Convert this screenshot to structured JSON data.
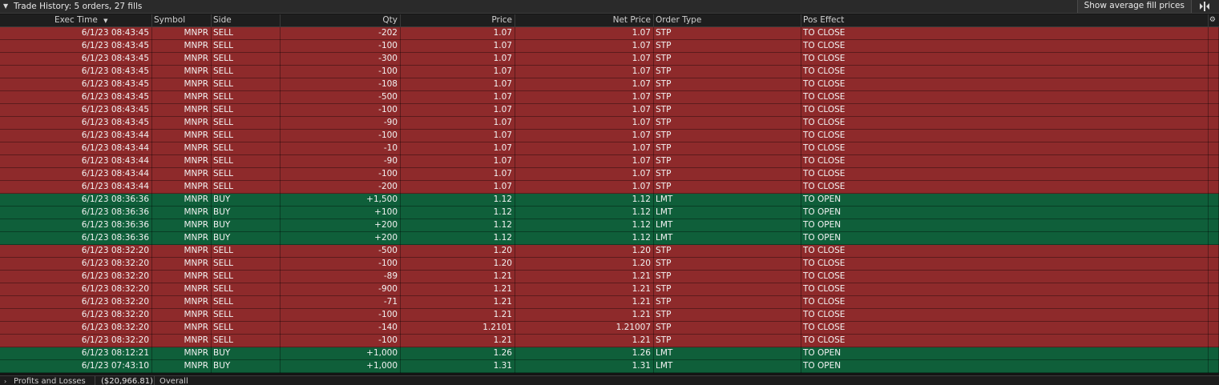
{
  "panel": {
    "title": "Trade History: 5 orders, 27 fills",
    "avg_fill_label": "Show average fill prices"
  },
  "columns": {
    "exec_time": "Exec Time",
    "symbol": "Symbol",
    "side": "Side",
    "qty": "Qty",
    "price": "Price",
    "net_price": "Net Price",
    "order_type": "Order Type",
    "pos_effect": "Pos Effect"
  },
  "colors": {
    "sell_row": "#8e2a2b",
    "buy_row": "#0f5f3a"
  },
  "fills": [
    {
      "time": "6/1/23 08:43:45",
      "symbol": "MNPR",
      "side": "SELL",
      "qty": "-202",
      "price": "1.07",
      "net": "1.07",
      "type": "STP",
      "pos": "TO CLOSE"
    },
    {
      "time": "6/1/23 08:43:45",
      "symbol": "MNPR",
      "side": "SELL",
      "qty": "-100",
      "price": "1.07",
      "net": "1.07",
      "type": "STP",
      "pos": "TO CLOSE"
    },
    {
      "time": "6/1/23 08:43:45",
      "symbol": "MNPR",
      "side": "SELL",
      "qty": "-300",
      "price": "1.07",
      "net": "1.07",
      "type": "STP",
      "pos": "TO CLOSE"
    },
    {
      "time": "6/1/23 08:43:45",
      "symbol": "MNPR",
      "side": "SELL",
      "qty": "-100",
      "price": "1.07",
      "net": "1.07",
      "type": "STP",
      "pos": "TO CLOSE"
    },
    {
      "time": "6/1/23 08:43:45",
      "symbol": "MNPR",
      "side": "SELL",
      "qty": "-108",
      "price": "1.07",
      "net": "1.07",
      "type": "STP",
      "pos": "TO CLOSE"
    },
    {
      "time": "6/1/23 08:43:45",
      "symbol": "MNPR",
      "side": "SELL",
      "qty": "-500",
      "price": "1.07",
      "net": "1.07",
      "type": "STP",
      "pos": "TO CLOSE"
    },
    {
      "time": "6/1/23 08:43:45",
      "symbol": "MNPR",
      "side": "SELL",
      "qty": "-100",
      "price": "1.07",
      "net": "1.07",
      "type": "STP",
      "pos": "TO CLOSE"
    },
    {
      "time": "6/1/23 08:43:45",
      "symbol": "MNPR",
      "side": "SELL",
      "qty": "-90",
      "price": "1.07",
      "net": "1.07",
      "type": "STP",
      "pos": "TO CLOSE"
    },
    {
      "time": "6/1/23 08:43:44",
      "symbol": "MNPR",
      "side": "SELL",
      "qty": "-100",
      "price": "1.07",
      "net": "1.07",
      "type": "STP",
      "pos": "TO CLOSE"
    },
    {
      "time": "6/1/23 08:43:44",
      "symbol": "MNPR",
      "side": "SELL",
      "qty": "-10",
      "price": "1.07",
      "net": "1.07",
      "type": "STP",
      "pos": "TO CLOSE"
    },
    {
      "time": "6/1/23 08:43:44",
      "symbol": "MNPR",
      "side": "SELL",
      "qty": "-90",
      "price": "1.07",
      "net": "1.07",
      "type": "STP",
      "pos": "TO CLOSE"
    },
    {
      "time": "6/1/23 08:43:44",
      "symbol": "MNPR",
      "side": "SELL",
      "qty": "-100",
      "price": "1.07",
      "net": "1.07",
      "type": "STP",
      "pos": "TO CLOSE"
    },
    {
      "time": "6/1/23 08:43:44",
      "symbol": "MNPR",
      "side": "SELL",
      "qty": "-200",
      "price": "1.07",
      "net": "1.07",
      "type": "STP",
      "pos": "TO CLOSE"
    },
    {
      "time": "6/1/23 08:36:36",
      "symbol": "MNPR",
      "side": "BUY",
      "qty": "+1,500",
      "price": "1.12",
      "net": "1.12",
      "type": "LMT",
      "pos": "TO OPEN"
    },
    {
      "time": "6/1/23 08:36:36",
      "symbol": "MNPR",
      "side": "BUY",
      "qty": "+100",
      "price": "1.12",
      "net": "1.12",
      "type": "LMT",
      "pos": "TO OPEN"
    },
    {
      "time": "6/1/23 08:36:36",
      "symbol": "MNPR",
      "side": "BUY",
      "qty": "+200",
      "price": "1.12",
      "net": "1.12",
      "type": "LMT",
      "pos": "TO OPEN"
    },
    {
      "time": "6/1/23 08:36:36",
      "symbol": "MNPR",
      "side": "BUY",
      "qty": "+200",
      "price": "1.12",
      "net": "1.12",
      "type": "LMT",
      "pos": "TO OPEN"
    },
    {
      "time": "6/1/23 08:32:20",
      "symbol": "MNPR",
      "side": "SELL",
      "qty": "-500",
      "price": "1.20",
      "net": "1.20",
      "type": "STP",
      "pos": "TO CLOSE"
    },
    {
      "time": "6/1/23 08:32:20",
      "symbol": "MNPR",
      "side": "SELL",
      "qty": "-100",
      "price": "1.20",
      "net": "1.20",
      "type": "STP",
      "pos": "TO CLOSE"
    },
    {
      "time": "6/1/23 08:32:20",
      "symbol": "MNPR",
      "side": "SELL",
      "qty": "-89",
      "price": "1.21",
      "net": "1.21",
      "type": "STP",
      "pos": "TO CLOSE"
    },
    {
      "time": "6/1/23 08:32:20",
      "symbol": "MNPR",
      "side": "SELL",
      "qty": "-900",
      "price": "1.21",
      "net": "1.21",
      "type": "STP",
      "pos": "TO CLOSE"
    },
    {
      "time": "6/1/23 08:32:20",
      "symbol": "MNPR",
      "side": "SELL",
      "qty": "-71",
      "price": "1.21",
      "net": "1.21",
      "type": "STP",
      "pos": "TO CLOSE"
    },
    {
      "time": "6/1/23 08:32:20",
      "symbol": "MNPR",
      "side": "SELL",
      "qty": "-100",
      "price": "1.21",
      "net": "1.21",
      "type": "STP",
      "pos": "TO CLOSE"
    },
    {
      "time": "6/1/23 08:32:20",
      "symbol": "MNPR",
      "side": "SELL",
      "qty": "-140",
      "price": "1.2101",
      "net": "1.21007",
      "type": "STP",
      "pos": "TO CLOSE"
    },
    {
      "time": "6/1/23 08:32:20",
      "symbol": "MNPR",
      "side": "SELL",
      "qty": "-100",
      "price": "1.21",
      "net": "1.21",
      "type": "STP",
      "pos": "TO CLOSE"
    },
    {
      "time": "6/1/23 08:12:21",
      "symbol": "MNPR",
      "side": "BUY",
      "qty": "+1,000",
      "price": "1.26",
      "net": "1.26",
      "type": "LMT",
      "pos": "TO OPEN"
    },
    {
      "time": "6/1/23 07:43:10",
      "symbol": "MNPR",
      "side": "BUY",
      "qty": "+1,000",
      "price": "1.31",
      "net": "1.31",
      "type": "LMT",
      "pos": "TO OPEN"
    }
  ],
  "footer": {
    "section_label": "Profits and Losses",
    "pnl_value": "($20,966.81)",
    "scope_label": "Overall"
  },
  "icons": {
    "collapse": "chevron-down-icon",
    "sort": "sort-desc-icon",
    "layout": "split-view-icon",
    "settings": "gear-icon",
    "expand": "chevron-right-icon"
  }
}
